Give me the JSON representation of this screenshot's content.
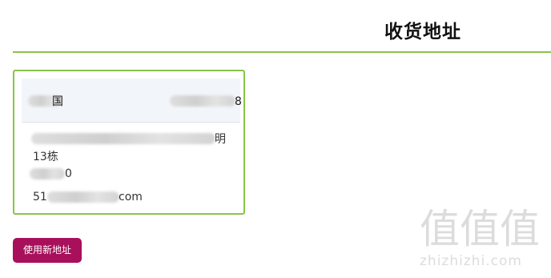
{
  "header": {
    "title": "收货地址"
  },
  "address_card": {
    "name_tail": "国",
    "phone_tail": "8",
    "street_tail": "明",
    "building": "13栋",
    "postal_tail": "0",
    "email_prefix": "51",
    "email_suffix": "com"
  },
  "actions": {
    "new_address_label": "使用新地址"
  },
  "watermark": {
    "glyphs": "值值值",
    "domain": "zhizhizhi.com"
  },
  "colors": {
    "accent_green": "#8bc34a",
    "button_bg": "#a8105c",
    "card_header_bg": "#f2f6fb"
  }
}
